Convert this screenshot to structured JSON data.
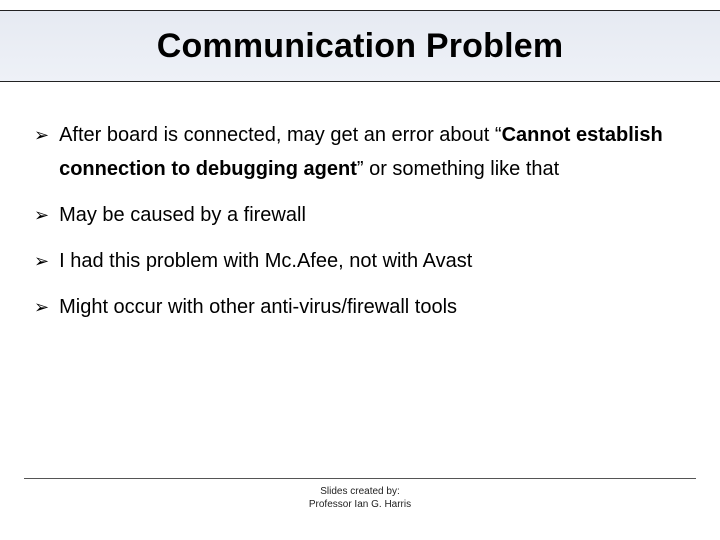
{
  "title": "Communication Problem",
  "bullets": [
    {
      "pre": "After board is connected, may get an error about “",
      "bold": "Cannot establish connection to debugging agent",
      "post": "” or something like that"
    },
    {
      "pre": "May be caused by a firewall",
      "bold": "",
      "post": ""
    },
    {
      "pre": "I had this problem with Mc.Afee, not with Avast",
      "bold": "",
      "post": ""
    },
    {
      "pre": "Might occur with other anti-virus/firewall tools",
      "bold": "",
      "post": ""
    }
  ],
  "footer": {
    "line1": "Slides created by:",
    "line2": "Professor Ian G. Harris"
  },
  "marker_glyph": "➢"
}
